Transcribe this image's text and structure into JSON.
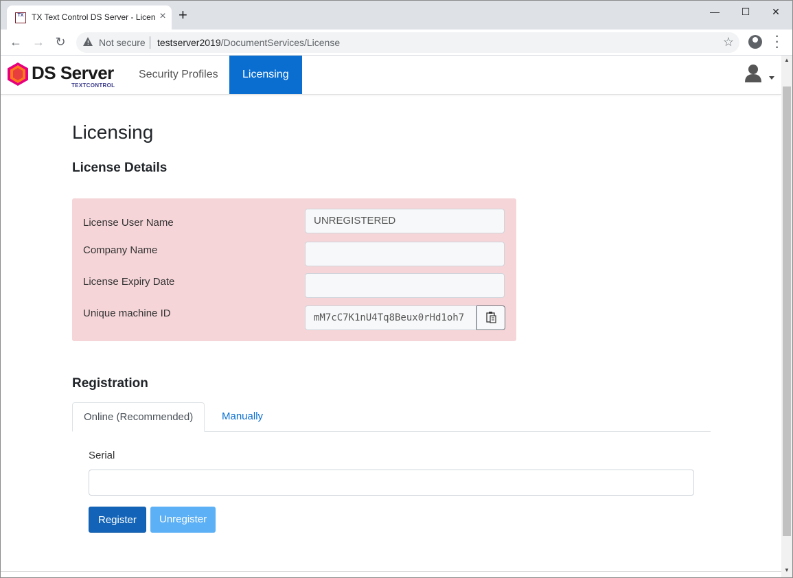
{
  "browser": {
    "tab_title": "TX Text Control DS Server - License",
    "tab_favicon_text": "TX",
    "security": "Not secure",
    "url_host": "testserver2019",
    "url_path": "/DocumentServices/License"
  },
  "app": {
    "logo_text": "DS Server",
    "logo_sub": "TEXTCONTROL",
    "nav": [
      {
        "label": "Security Profiles",
        "active": false
      },
      {
        "label": "Licensing",
        "active": true
      }
    ]
  },
  "page": {
    "title": "Licensing",
    "details_heading": "License Details",
    "fields": [
      {
        "label": "License User Name",
        "value": "UNREGISTERED"
      },
      {
        "label": "Company Name",
        "value": ""
      },
      {
        "label": "License Expiry Date",
        "value": ""
      },
      {
        "label": "Unique machine ID",
        "value": "mM7cC7K1nU4Tq8Beux0rHd1oh7"
      }
    ],
    "registration_heading": "Registration",
    "tabs": [
      {
        "label": "Online (Recommended)",
        "active": true
      },
      {
        "label": "Manually",
        "active": false
      }
    ],
    "serial_label": "Serial",
    "serial_value": "",
    "register_label": "Register",
    "unregister_label": "Unregister"
  },
  "colors": {
    "accent": "#0a6ed1",
    "alert_bg": "#f5d5d8",
    "button_primary": "#1364b8",
    "button_disabled": "#5cb0f5"
  }
}
